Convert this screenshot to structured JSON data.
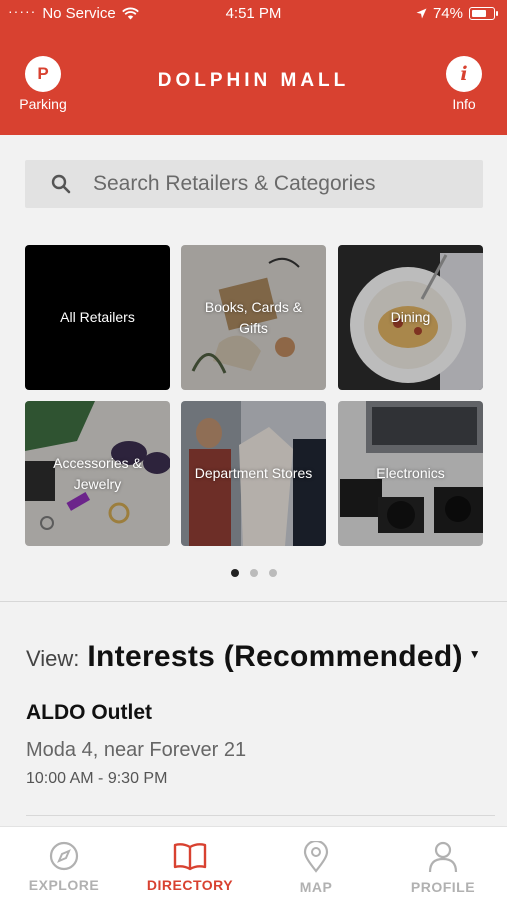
{
  "status_bar": {
    "carrier": "No Service",
    "time": "4:51 PM",
    "battery": "74%",
    "battery_level": 0.74
  },
  "header": {
    "title": "DOLPHIN MALL",
    "parking_glyph": "P",
    "parking_label": "Parking",
    "info_glyph": "i",
    "info_label": "Info",
    "background_color": "#d84130"
  },
  "search": {
    "placeholder": "Search Retailers & Categories",
    "icon": "search-icon"
  },
  "categories": [
    {
      "label": "All Retailers"
    },
    {
      "label": "Books, Cards & Gifts"
    },
    {
      "label": "Dining"
    },
    {
      "label": "Accessories & Jewelry"
    },
    {
      "label": "Department Stores"
    },
    {
      "label": "Electronics"
    }
  ],
  "pagination": {
    "pages": 3,
    "active": 1
  },
  "view": {
    "label": "View:",
    "value": "Interests (Recommended)"
  },
  "stores": [
    {
      "name": "ALDO Outlet",
      "location": "Moda 4, near Forever 21",
      "hours": "10:00 AM - 9:30 PM"
    }
  ],
  "tabs": [
    {
      "label": "EXPLORE",
      "icon": "compass-icon",
      "active": false
    },
    {
      "label": "DIRECTORY",
      "icon": "book-icon",
      "active": true
    },
    {
      "label": "MAP",
      "icon": "map-pin-icon",
      "active": false
    },
    {
      "label": "PROFILE",
      "icon": "person-icon",
      "active": false
    }
  ],
  "colors": {
    "accent": "#d84130",
    "inactive_tab": "#b1b1b1"
  }
}
